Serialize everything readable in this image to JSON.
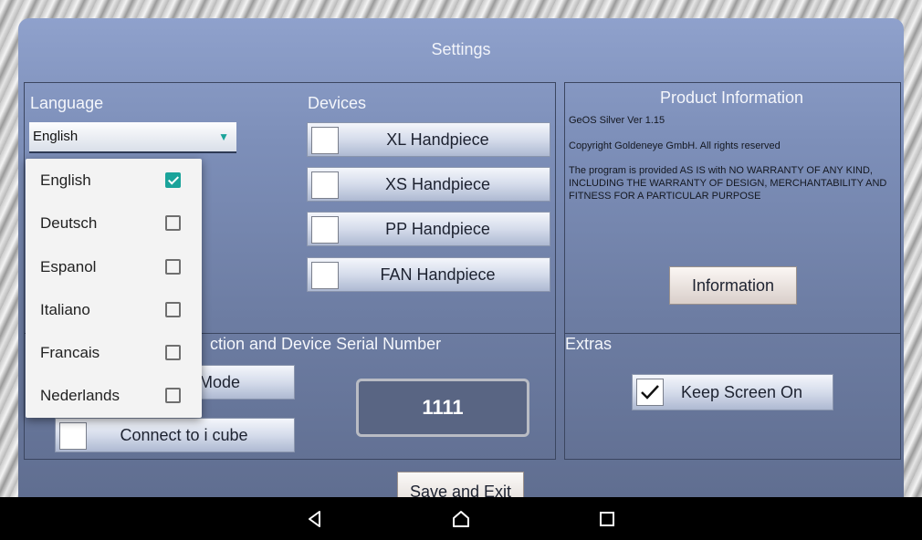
{
  "header": {
    "title": "Settings"
  },
  "language": {
    "label": "Language",
    "selected": "English",
    "options": [
      {
        "label": "English",
        "checked": true
      },
      {
        "label": "Deutsch",
        "checked": false
      },
      {
        "label": "Espanol",
        "checked": false
      },
      {
        "label": "Italiano",
        "checked": false
      },
      {
        "label": "Francais",
        "checked": false
      },
      {
        "label": "Nederlands",
        "checked": false
      }
    ]
  },
  "devices": {
    "label": "Devices",
    "items": [
      {
        "label": "XL Handpiece",
        "checked": false
      },
      {
        "label": "XS Handpiece",
        "checked": false
      },
      {
        "label": "PP Handpiece",
        "checked": false
      },
      {
        "label": "FAN Handpiece",
        "checked": false
      }
    ]
  },
  "product_info": {
    "title": "Product Information",
    "version": "GeOS Silver Ver 1.15",
    "copyright": "Copyright Goldeneye GmbH. All rights reserved",
    "disclaimer": "The program is provided AS IS with NO WARRANTY OF ANY KIND, INCLUDING THE WARRANTY OF DESIGN, MERCHANTABILITY AND FITNESS FOR A PARTICULAR PURPOSE",
    "button_label": "Information"
  },
  "connection": {
    "label_visible": "ction and Device Serial Number",
    "mode_button_visible": "Mode",
    "connect_label": "Connect to i cube",
    "serial": "1111"
  },
  "extras": {
    "label": "Extras",
    "keep_screen_label": "Keep Screen On",
    "keep_screen_checked": true
  },
  "footer": {
    "save_label": "Save and Exit"
  },
  "colors": {
    "accent": "#1aa39a",
    "panel": "#7d8fb9"
  }
}
